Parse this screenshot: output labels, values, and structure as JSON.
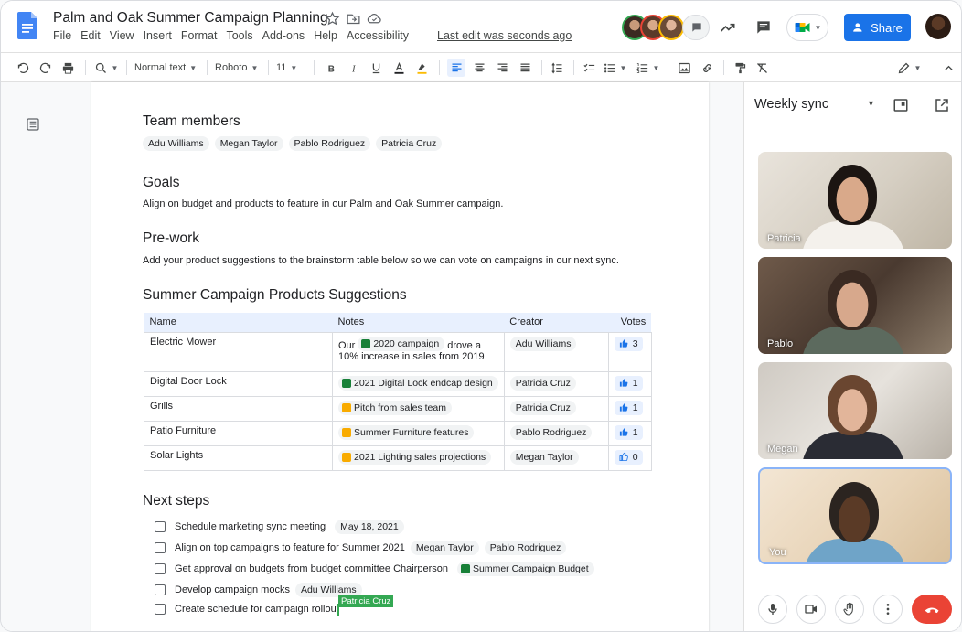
{
  "header": {
    "title": "Palm and Oak Summer Campaign Planning",
    "menu": [
      "File",
      "Edit",
      "View",
      "Insert",
      "Format",
      "Tools",
      "Add-ons",
      "Help",
      "Accessibility"
    ],
    "last_edit": "Last edit was seconds ago",
    "share_label": "Share"
  },
  "toolbar": {
    "style": "Normal text",
    "font": "Roboto",
    "size": "11"
  },
  "doc": {
    "team_heading": "Team members",
    "team": [
      "Adu Williams",
      "Megan Taylor",
      "Pablo Rodriguez",
      "Patricia Cruz"
    ],
    "goals_heading": "Goals",
    "goals_text": "Align on budget and products to feature in our Palm and Oak Summer campaign.",
    "prework_heading": "Pre-work",
    "prework_text": "Add your product suggestions to the brainstorm table below so we can vote on campaigns in our next sync.",
    "table_heading": "Summer Campaign Products Suggestions",
    "table": {
      "columns": [
        "Name",
        "Notes",
        "Creator",
        "Votes"
      ],
      "rows": [
        {
          "name": "Electric Mower",
          "note_pre": "Our",
          "note_chip": "2020 campaign",
          "note_post": "drove a",
          "note_line2": "10% increase in sales from 2019",
          "creator": "Adu Williams",
          "votes": "3"
        },
        {
          "name": "Digital Door Lock",
          "note_chip": "2021 Digital Lock endcap design",
          "creator": "Patricia Cruz",
          "votes": "1"
        },
        {
          "name": "Grills",
          "note_chip": "Pitch from sales team",
          "creator": "Patricia Cruz",
          "votes": "1"
        },
        {
          "name": "Patio Furniture",
          "note_chip": "Summer Furniture features",
          "creator": "Pablo Rodriguez",
          "votes": "1"
        },
        {
          "name": "Solar Lights",
          "note_chip": "2021 Lighting sales projections",
          "creator": "Megan Taylor",
          "votes": "0"
        }
      ]
    },
    "next_heading": "Next steps",
    "steps": [
      {
        "text": "Schedule marketing sync meeting",
        "chip": "May 18, 2021"
      },
      {
        "text": "Align on top campaigns to feature for Summer 2021",
        "chip": "Megan Taylor",
        "chip2": "Pablo Rodriguez"
      },
      {
        "text": "Get approval on budgets from budget committee Chairperson",
        "chip": "Summer Campaign Budget"
      },
      {
        "text": "Develop campaign mocks",
        "chip": "Adu Williams"
      },
      {
        "text": "Create schedule for campaign rollout"
      }
    ],
    "cursor_user": "Patricia Cruz"
  },
  "meet": {
    "title": "Weekly sync",
    "participants": [
      "Patricia",
      "Pablo",
      "Megan",
      "You"
    ]
  },
  "colors": {
    "accent": "#1a73e8",
    "sheet": "#188038",
    "slide": "#f9ab00",
    "hangup": "#ea4335",
    "cursor": "#34a853"
  }
}
